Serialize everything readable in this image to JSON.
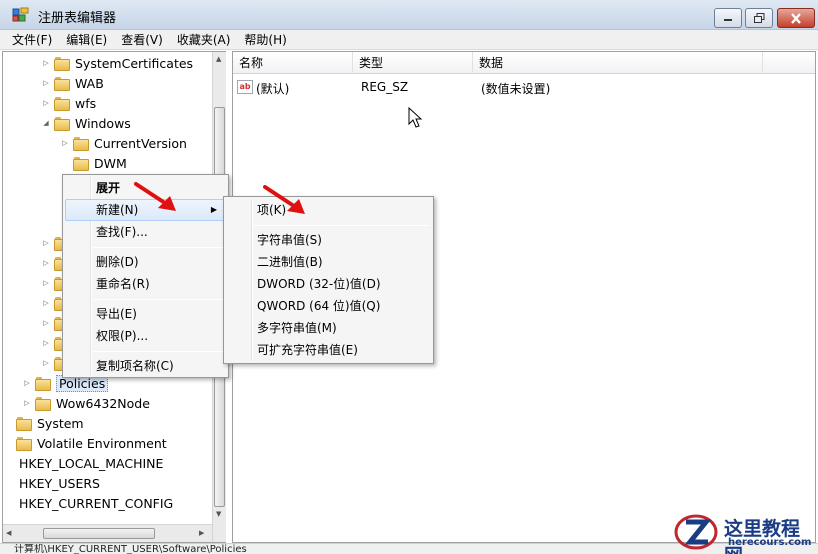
{
  "window": {
    "title": "注册表编辑器"
  },
  "menubar": [
    "文件(F)",
    "编辑(E)",
    "查看(V)",
    "收藏夹(A)",
    "帮助(H)"
  ],
  "tree": {
    "items": [
      {
        "label": "SystemCertificates",
        "toggle": "▷",
        "folder": true
      },
      {
        "label": "WAB",
        "toggle": "▷",
        "folder": true
      },
      {
        "label": "wfs",
        "toggle": "▷",
        "folder": true
      },
      {
        "label": "Windows",
        "toggle": "◢",
        "folder": true
      },
      {
        "label": "CurrentVersion",
        "toggle": "▷",
        "folder": true
      },
      {
        "label": "DWM",
        "toggle": "",
        "folder": true
      },
      {
        "label": "Policies",
        "toggle": "▷",
        "folder": true,
        "selected": true
      },
      {
        "label": "Wow6432Node",
        "toggle": "▷",
        "folder": true
      },
      {
        "label": "System",
        "toggle": "",
        "folder": true
      },
      {
        "label": "Volatile Environment",
        "toggle": "",
        "folder": true
      },
      {
        "label": "HKEY_LOCAL_MACHINE",
        "toggle": "",
        "folder": false
      },
      {
        "label": "HKEY_USERS",
        "toggle": "",
        "folder": false
      },
      {
        "label": "HKEY_CURRENT_CONFIG",
        "toggle": "",
        "folder": false
      }
    ]
  },
  "list": {
    "columns": [
      "名称",
      "类型",
      "数据"
    ],
    "rows": [
      {
        "icon": "ab",
        "name": "(默认)",
        "type": "REG_SZ",
        "data": "(数值未设置)"
      }
    ]
  },
  "context_menu": {
    "items": [
      "展开",
      "新建(N)",
      "查找(F)...",
      "删除(D)",
      "重命名(R)",
      "导出(E)",
      "权限(P)...",
      "复制项名称(C)"
    ],
    "submenu_marker": "▶"
  },
  "submenu": {
    "items": [
      "项(K)",
      "字符串值(S)",
      "二进制值(B)",
      "DWORD (32-位)值(D)",
      "QWORD (64 位)值(Q)",
      "多字符串值(M)",
      "可扩充字符串值(E)"
    ]
  },
  "status": {
    "text": "计算机\\HKEY_CURRENT_USER\\Software\\Policies"
  },
  "watermark": {
    "text": "这里教程网",
    "url": "herecours.com"
  },
  "colors": {
    "highlight": "#dce9f9",
    "arrow": "#e01010",
    "watermark": "#1a3c85"
  }
}
